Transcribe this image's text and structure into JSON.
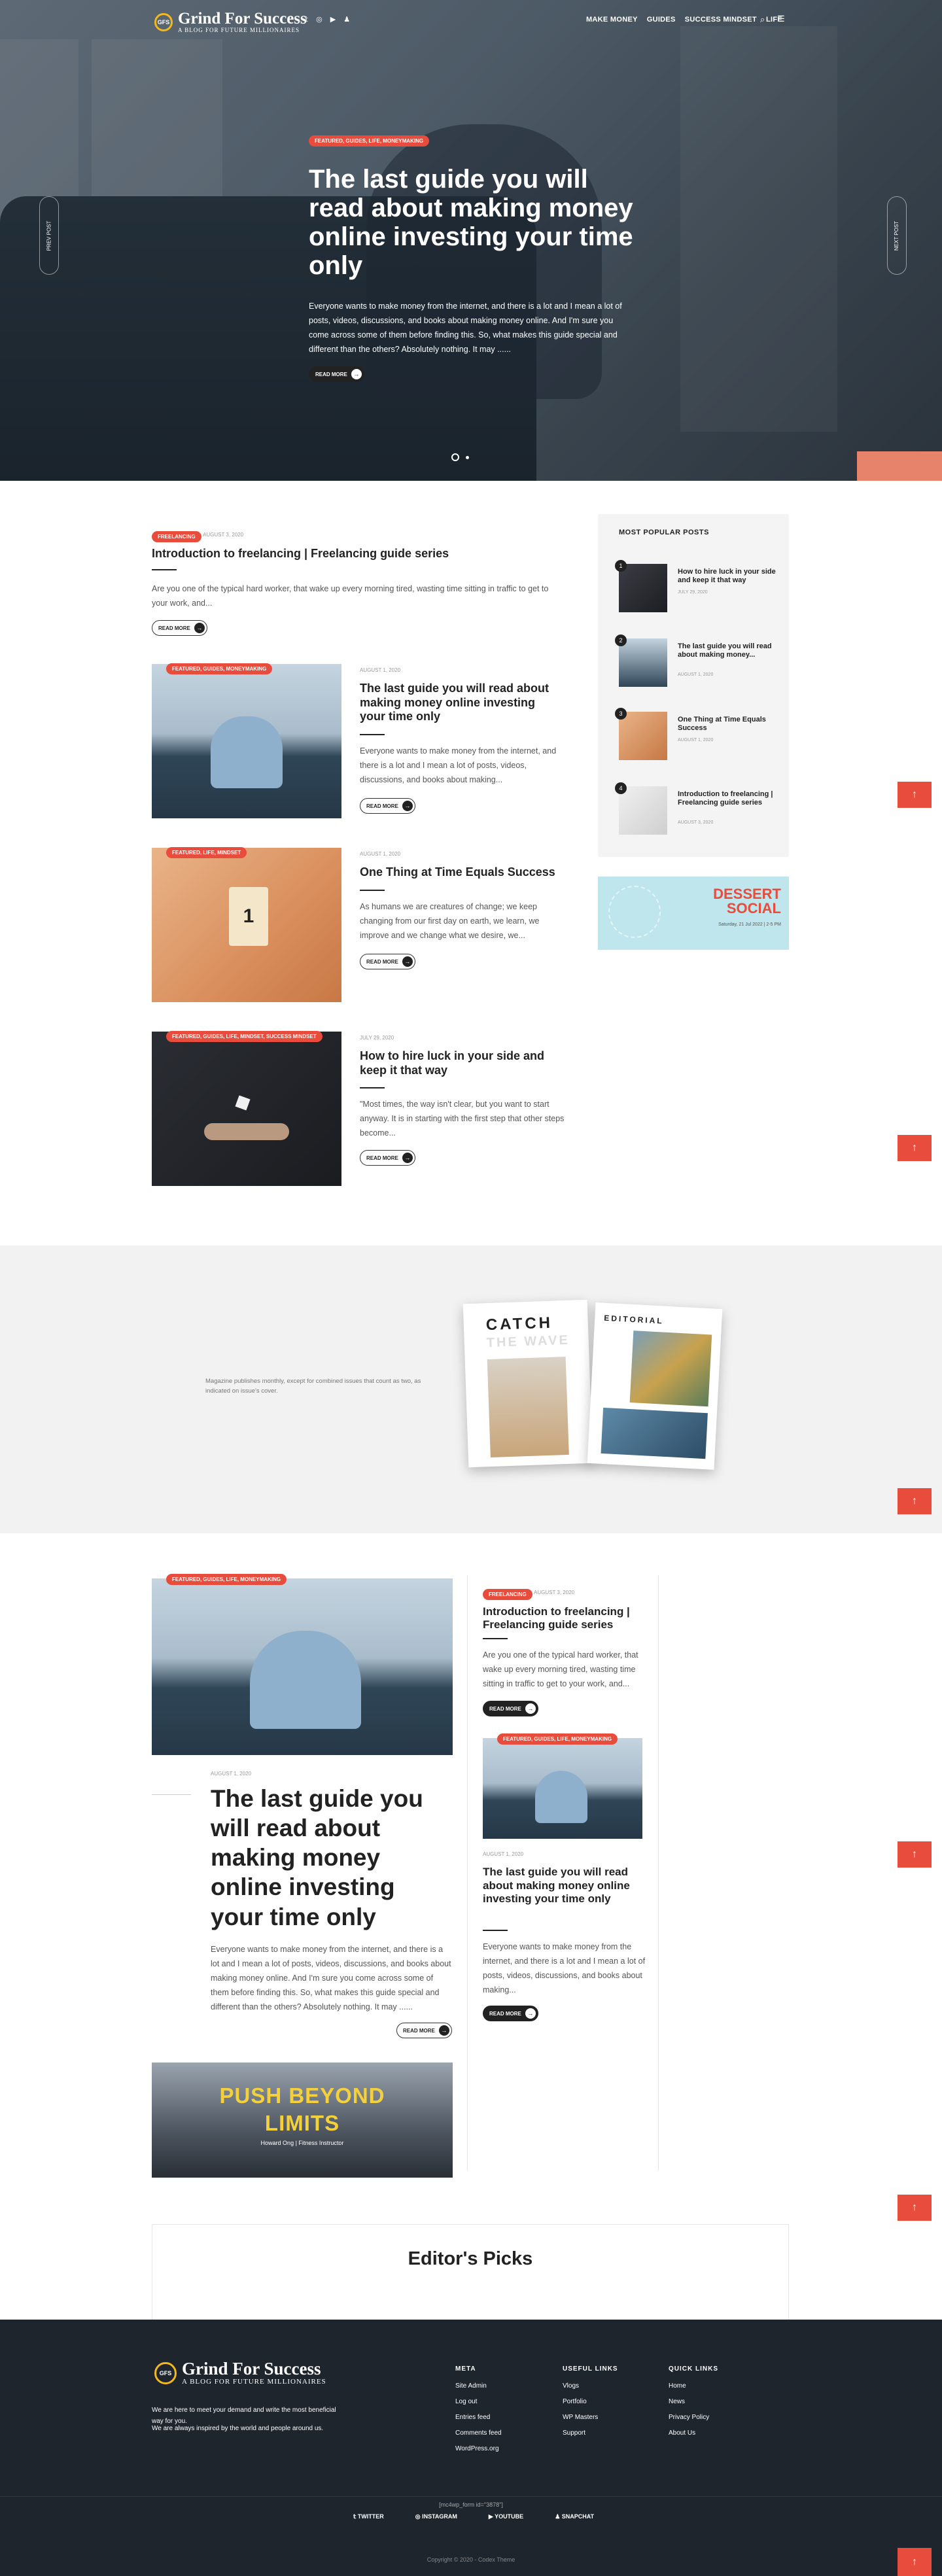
{
  "brand": {
    "name": "Grind For Success",
    "tagline": "A BLOG FOR FUTURE MILLIONAIRES",
    "mark": "GFS"
  },
  "nav": {
    "items": [
      "MAKE MONEY",
      "GUIDES",
      "SUCCESS MINDSET",
      "LIFE"
    ]
  },
  "hero": {
    "badge": "FEATURED, GUIDES, LIFE, MONEYMAKING",
    "title": "The last guide you will read about making money online investing your time only",
    "excerpt": "Everyone wants to make money from the internet, and there is a lot and I mean a lot of posts, videos, discussions, and books about making money online. And I'm sure you come across some of them before finding this. So, what makes this guide special and different than the others? Absolutely nothing. It may ......",
    "read_more": "READ MORE",
    "prev": "PREV POST",
    "next": "NEXT POST"
  },
  "featured_top": {
    "badge": "FREELANCING",
    "date": "AUGUST 3, 2020",
    "title": "Introduction to freelancing | Freelancing guide series",
    "excerpt": "Are you one of the typical hard worker, that wake up every morning tired, wasting time sitting in traffic to get to your work, and...",
    "read_more": "READ MORE"
  },
  "posts": [
    {
      "badge": "FEATURED, GUIDES, MONEYMAKING",
      "date": "AUGUST 1, 2020",
      "title": "The last guide you will read about making money online investing your time only",
      "excerpt": "Everyone wants to make money from the internet, and there is a lot and I mean a lot of posts, videos, discussions, and books about making...",
      "read_more": "READ MORE"
    },
    {
      "badge": "FEATURED, LIFE, MINDSET",
      "date": "AUGUST 1, 2020",
      "title": "One Thing at Time Equals Success",
      "excerpt": "As humans we are creatures of change; we keep changing from our first day on earth, we learn, we improve and we change what we desire, we...",
      "read_more": "READ MORE"
    },
    {
      "badge": "FEATURED, GUIDES, LIFE, MINDSET, SUCCESS MINDSET",
      "date": "JULY 29, 2020",
      "title": "How to hire luck in your side and keep it that way",
      "excerpt": "\"Most times, the way isn't clear, but you want to start anyway. It is in starting with the first step that other steps become...",
      "read_more": "READ MORE"
    }
  ],
  "popular": {
    "heading": "MOST POPULAR POSTS",
    "items": [
      {
        "num": "1",
        "title": "How to hire luck in your side and keep it that way",
        "date": "JULY 29, 2020"
      },
      {
        "num": "2",
        "title": "The last guide you will read about making money...",
        "date": "AUGUST 1, 2020"
      },
      {
        "num": "3",
        "title": "One Thing at Time Equals Success",
        "date": "AUGUST 1, 2020"
      },
      {
        "num": "4",
        "title": "Introduction to freelancing | Freelancing guide series",
        "date": "AUGUST 3, 2020"
      }
    ]
  },
  "ad": {
    "title": "DESSERT SOCIAL",
    "sub": "Saturday, 21 Jul 2022 | 2-5 PM"
  },
  "magazine": {
    "text": "Magazine publishes monthly, except for combined issues that count as two, as indicated on issue's cover.",
    "cover_a": "CATCH",
    "cover_b": "THE WAVE",
    "cover_c": "EDITORIAL"
  },
  "grid": {
    "big": {
      "badge": "FEATURED, GUIDES, LIFE, MONEYMAKING",
      "date": "AUGUST 1, 2020",
      "title": "The last guide you will read about making money online investing your time only",
      "excerpt": "Everyone wants to make money from the internet, and there is a lot and I mean a lot of posts, videos, discussions, and books about making money online. And I'm sure you come across some of them before finding this. So, what makes this guide special and different than the others? Absolutely nothing. It may ......",
      "read_more": "READ MORE"
    },
    "side1": {
      "badge": "FREELANCING",
      "date": "AUGUST 3, 2020",
      "title": "Introduction to freelancing | Freelancing guide series",
      "excerpt": "Are you one of the typical hard worker, that wake up every morning tired, wasting time sitting in traffic to get to your work, and...",
      "read_more": "READ MORE"
    },
    "side2": {
      "badge": "FEATURED, GUIDES, LIFE, MONEYMAKING",
      "date": "AUGUST 1, 2020",
      "title": "The last guide you will read about making money online investing your time only",
      "excerpt": "Everyone wants to make money from the internet, and there is a lot and I mean a lot of posts, videos, discussions, and books about making...",
      "read_more": "READ MORE"
    },
    "banner": {
      "line1": "PUSH BEYOND",
      "line2": "LIMITS",
      "sub": "Howard Ong | Fitness Instructor"
    }
  },
  "editors": {
    "title": "Editor's Picks"
  },
  "footer": {
    "about": [
      "We are here to meet your demand and write the most beneficial way for you.",
      "We are always inspired by the world and people around us."
    ],
    "cols": [
      {
        "heading": "META",
        "links": [
          "Site Admin",
          "Log out",
          "Entries feed",
          "Comments feed",
          "WordPress.org"
        ]
      },
      {
        "heading": "USEFUL LINKS",
        "links": [
          "Vlogs",
          "Portfolio",
          "WP Masters",
          "Support"
        ]
      },
      {
        "heading": "QUICK LINKS",
        "links": [
          "Home",
          "News",
          "Privacy Policy",
          "About Us"
        ]
      }
    ],
    "shortcode": "[mc4wp_form id=\"3878\"]",
    "social": [
      "TWITTER",
      "INSTAGRAM",
      "YOUTUBE",
      "SNAPCHAT"
    ],
    "copyright": "Copyright © 2020 - Codex Theme"
  },
  "up_arrow": "↑"
}
